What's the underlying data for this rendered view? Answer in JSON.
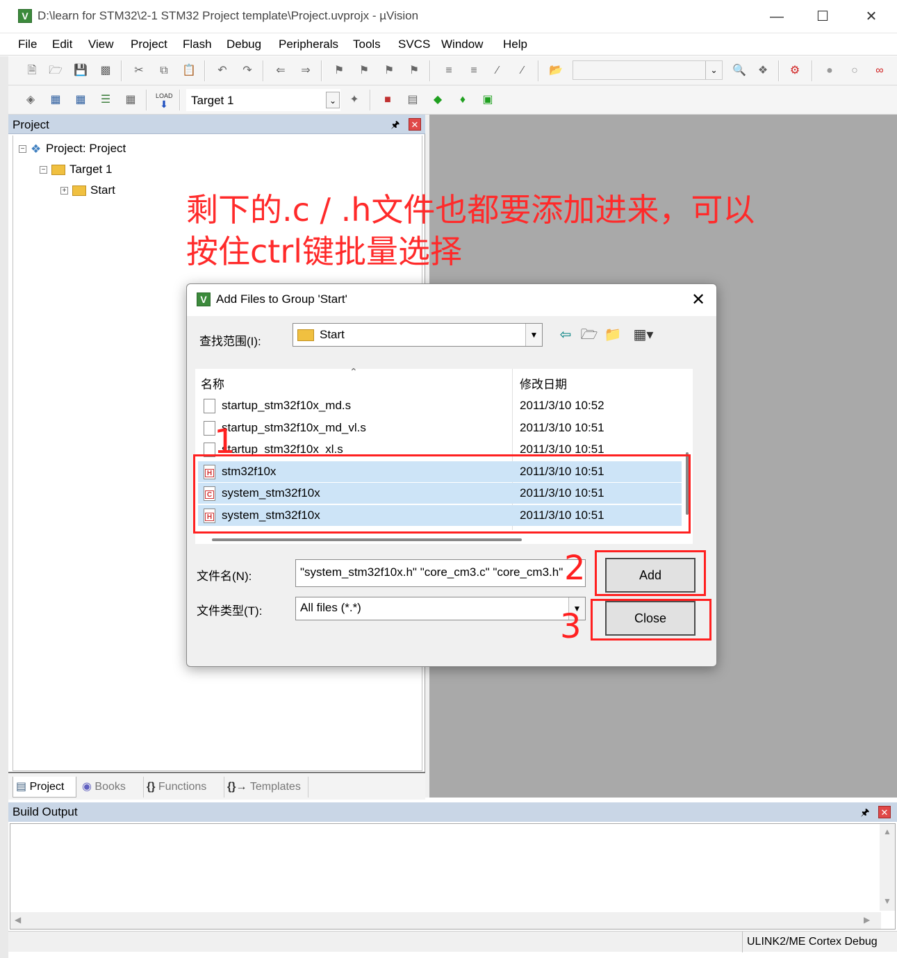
{
  "window": {
    "title": "D:\\learn for STM32\\2-1 STM32 Project template\\Project.uvprojx - µVision",
    "app_icon": "V"
  },
  "menu": [
    "File",
    "Edit",
    "View",
    "Project",
    "Flash",
    "Debug",
    "Peripherals",
    "Tools",
    "SVCS",
    "Window",
    "Help"
  ],
  "toolbar2": {
    "load_label": "LOAD",
    "target": "Target 1"
  },
  "project_panel": {
    "title": "Project",
    "tree": {
      "root": "Project: Project",
      "target": "Target 1",
      "group": "Start"
    },
    "tabs": [
      "Project",
      "Books",
      "Functions",
      "Templates"
    ]
  },
  "annotation": {
    "text": "剩下的.c / .h文件也都要添加进来，可以按住ctrl键批量选择",
    "numbers": [
      "1",
      "2",
      "3"
    ]
  },
  "dialog": {
    "title": "Add Files to Group 'Start'",
    "look_in_label": "查找范围(I):",
    "look_in_value": "Start",
    "columns": {
      "name": "名称",
      "date": "修改日期"
    },
    "files": [
      {
        "name": "startup_stm32f10x_md.s",
        "date": "2011/3/10 10:52",
        "type": "s",
        "selected": false
      },
      {
        "name": "startup_stm32f10x_md_vl.s",
        "date": "2011/3/10 10:51",
        "type": "s",
        "selected": false
      },
      {
        "name": "startup_stm32f10x_xl.s",
        "date": "2011/3/10 10:51",
        "type": "s",
        "selected": false
      },
      {
        "name": "stm32f10x",
        "date": "2011/3/10 10:51",
        "type": "h",
        "selected": true
      },
      {
        "name": "system_stm32f10x",
        "date": "2011/3/10 10:51",
        "type": "c",
        "selected": true
      },
      {
        "name": "system_stm32f10x",
        "date": "2011/3/10 10:51",
        "type": "h",
        "selected": true
      }
    ],
    "filename_label": "文件名(N):",
    "filename_value": "\"system_stm32f10x.h\" \"core_cm3.c\" \"core_cm3.h\"",
    "filetype_label": "文件类型(T):",
    "filetype_value": "All files (*.*)",
    "add_button": "Add",
    "close_button": "Close"
  },
  "build_output": {
    "title": "Build Output"
  },
  "status": {
    "debugger": "ULINK2/ME Cortex Debug"
  },
  "colors": {
    "annotation_red": "#ff2020",
    "panel_header": "#c9d6e6",
    "selection": "#cde4f7"
  }
}
